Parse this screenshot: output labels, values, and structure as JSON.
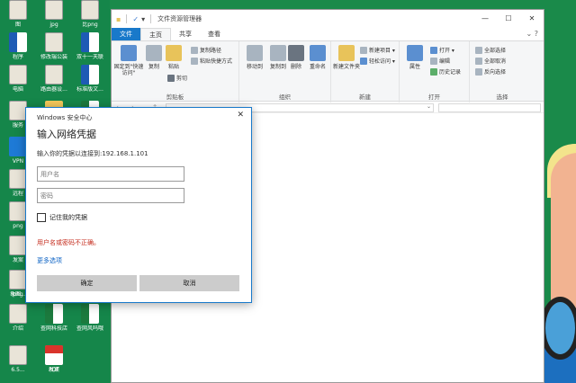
{
  "desktop": {
    "icons": [
      {
        "label": "图",
        "glyph": "img"
      },
      {
        "label": "jpg",
        "glyph": "img"
      },
      {
        "label": "比png",
        "glyph": "img"
      },
      {
        "label": "程序",
        "glyph": "word"
      },
      {
        "label": "修改瑞公装",
        "glyph": "img"
      },
      {
        "label": "双十一天联",
        "glyph": "word"
      },
      {
        "label": "电脑",
        "glyph": "img"
      },
      {
        "label": "路由器设...",
        "glyph": "img"
      },
      {
        "label": "标准版文...",
        "glyph": "word"
      },
      {
        "label": "服务",
        "glyph": "img"
      },
      {
        "label": "灵活宣贝",
        "glyph": "folder"
      },
      {
        "label": "云备份用户",
        "glyph": "excel"
      },
      {
        "label": "操作手册...",
        "glyph": "excel"
      },
      {
        "label": "VPN",
        "glyph": "vpn"
      },
      {
        "label": "远程",
        "glyph": "img"
      },
      {
        "label": "png",
        "glyph": "img"
      },
      {
        "label": "发案",
        "glyph": "img"
      },
      {
        "label": "png",
        "glyph": "img"
      },
      {
        "label": "介绍",
        "glyph": "img"
      },
      {
        "label": "6.5...",
        "glyph": "img"
      },
      {
        "label": "发案",
        "glyph": "img"
      },
      {
        "label": "象图...",
        "glyph": "img"
      },
      {
        "label": "查网科技店",
        "glyph": "excel"
      },
      {
        "label": "查网风吗哦",
        "glyph": "excel"
      },
      {
        "label": "铺二维码...",
        "glyph": "img"
      },
      {
        "label": "的建议联...",
        "glyph": "excel"
      },
      {
        "label": "PDF",
        "glyph": "pdf"
      }
    ]
  },
  "explorer": {
    "title": "文件资源管理器",
    "qat_glyphs": [
      "▪",
      "✓",
      "▾"
    ],
    "controls": {
      "minimize": "—",
      "maximize": "☐",
      "close": "✕"
    },
    "tabs": [
      {
        "label": "文件",
        "kind": "file"
      },
      {
        "label": "主页",
        "kind": "active"
      },
      {
        "label": "共享",
        "kind": "normal"
      },
      {
        "label": "查看",
        "kind": "normal"
      }
    ],
    "tabs_right": "⌄  ?",
    "ribbon": {
      "clipboard": {
        "name": "剪贴板",
        "pin": "固定到\"快速访问\"",
        "copy": "复制",
        "paste": "粘贴",
        "copy_path": "复制路径",
        "paste_shortcut": "粘贴快捷方式",
        "cut": "剪切"
      },
      "organize": {
        "name": "组织",
        "move_to": "移动到",
        "copy_to": "复制到",
        "delete": "删除",
        "rename": "重命名"
      },
      "new": {
        "name": "新建",
        "new_folder": "新建文件夹",
        "new_item": "新建项目 ▾",
        "easy_access": "轻松访问 ▾"
      },
      "open": {
        "name": "打开",
        "properties": "属性",
        "open": "打开 ▾",
        "edit": "编辑",
        "history": "历史记录"
      },
      "select": {
        "name": "选择",
        "select_all": "全部选择",
        "select_none": "全部取消",
        "invert": "反向选择"
      }
    },
    "nav": "←  →  ⌄  ↑",
    "addr_dropdown": "⌄"
  },
  "dialog": {
    "header": "Windows 安全中心",
    "close": "✕",
    "title": "输入网络凭据",
    "subtitle": "输入你的凭据以连接到:192.168.1.101",
    "username_placeholder": "用户名",
    "password_placeholder": "密码",
    "remember": "记住我的凭据",
    "error": "用户名或密码不正确。",
    "more": "更多选项",
    "ok": "确定",
    "cancel": "取消"
  }
}
